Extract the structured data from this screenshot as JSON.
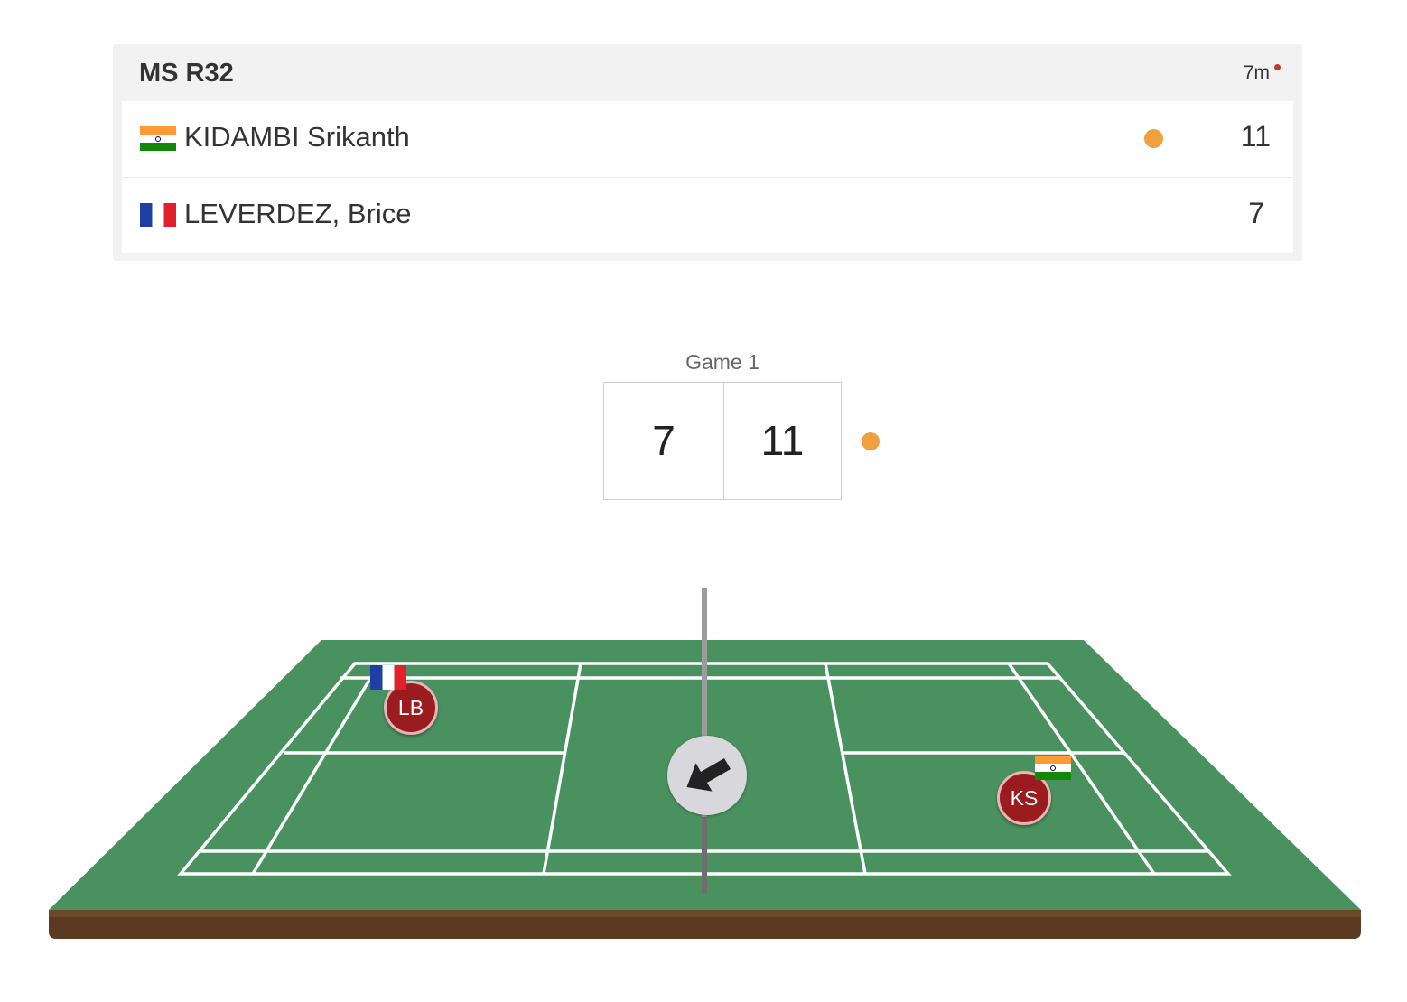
{
  "match": {
    "round": "MS R32",
    "elapsed": "7m"
  },
  "players": [
    {
      "name": "KIDAMBI Srikanth",
      "country": "India",
      "flag": "flag-india-icon",
      "score": "11",
      "serving": true
    },
    {
      "name": "LEVERDEZ, Brice",
      "country": "France",
      "flag": "flag-france-icon",
      "score": "7",
      "serving": false
    }
  ],
  "game": {
    "label": "Game 1",
    "left_score": "7",
    "right_score": "11",
    "serving_side": "right"
  },
  "court": {
    "left_player": {
      "initials": "LB",
      "flag": "flag-france-icon"
    },
    "right_player": {
      "initials": "KS",
      "flag": "flag-india-icon"
    },
    "direction_icon": "arrow-up-left-icon"
  },
  "colors": {
    "court_green": "#4a9160",
    "court_base": "#5a3a20",
    "serve_indicator": "#f0a03c",
    "player_token": "#9b1c1f",
    "live_dot": "#c0392b"
  }
}
